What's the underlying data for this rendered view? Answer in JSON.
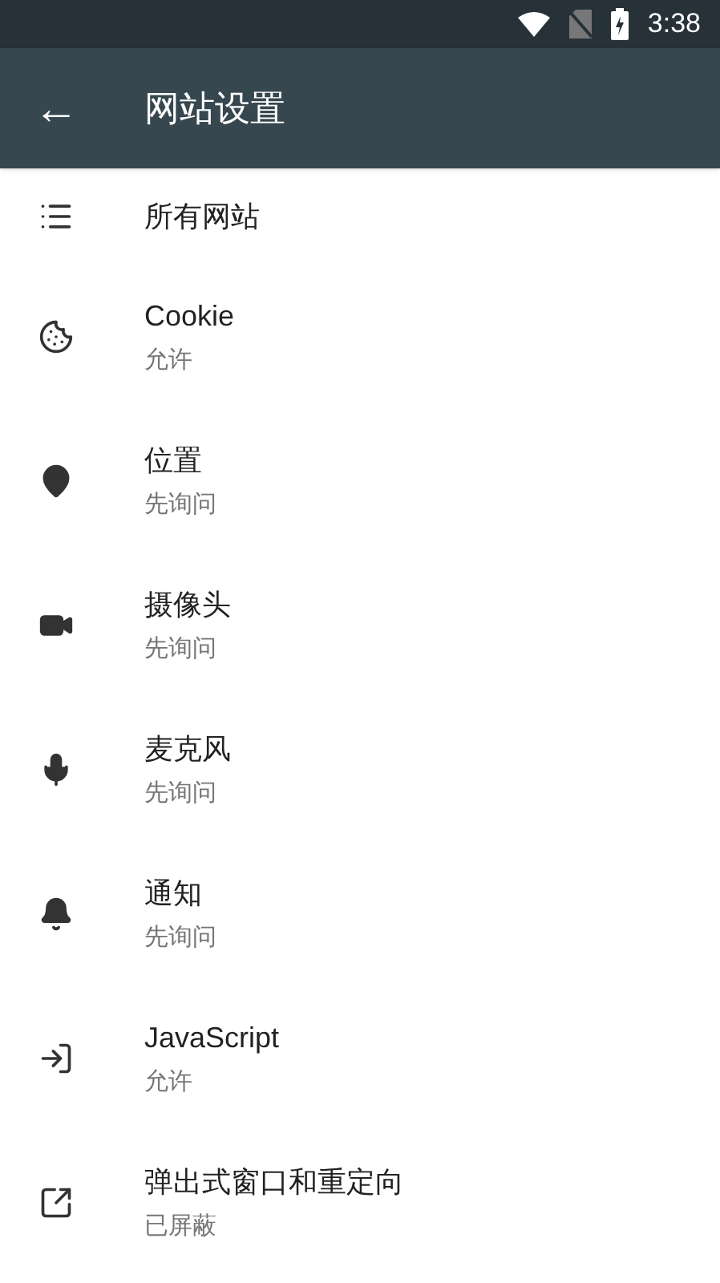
{
  "status_bar": {
    "time": "3:38"
  },
  "toolbar": {
    "back": "←",
    "title": "网站设置"
  },
  "items": [
    {
      "title": "所有网站"
    },
    {
      "title": "Cookie",
      "subtitle": "允许"
    },
    {
      "title": "位置",
      "subtitle": "先询问"
    },
    {
      "title": "摄像头",
      "subtitle": "先询问"
    },
    {
      "title": "麦克风",
      "subtitle": "先询问"
    },
    {
      "title": "通知",
      "subtitle": "先询问"
    },
    {
      "title": "JavaScript",
      "subtitle": "允许"
    },
    {
      "title": "弹出式窗口和重定向",
      "subtitle": "已屏蔽"
    }
  ]
}
